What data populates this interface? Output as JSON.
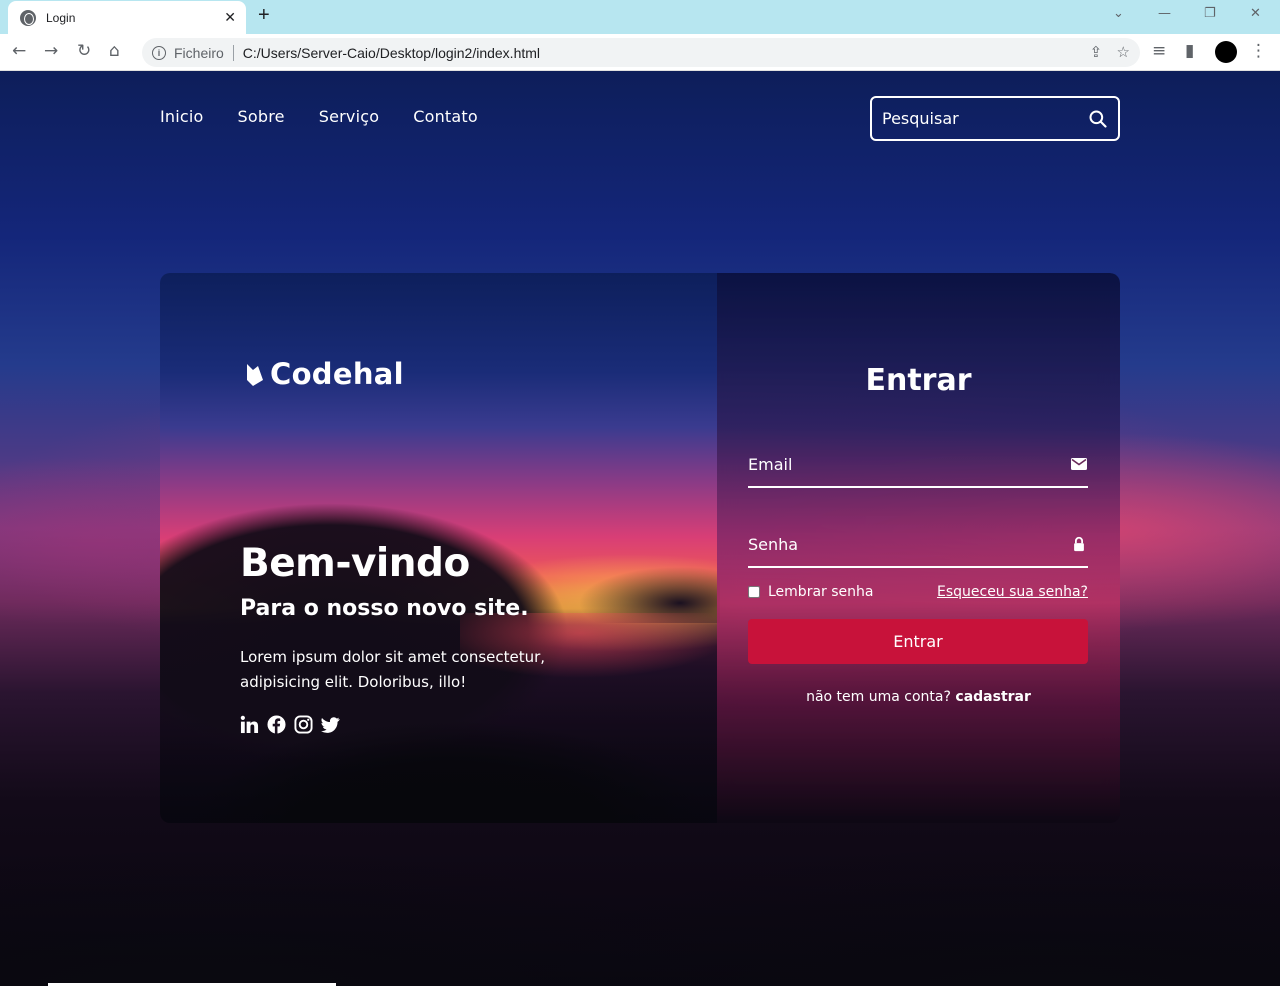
{
  "browser": {
    "tab_title": "Login",
    "tab_close": "✕",
    "new_tab": "+",
    "scheme_label": "Ficheiro",
    "url": "C:/Users/Server-Caio/Desktop/login2/index.html"
  },
  "nav": {
    "items": [
      "Inicio",
      "Sobre",
      "Serviço",
      "Contato"
    ]
  },
  "search": {
    "placeholder": "Pesquisar"
  },
  "card": {
    "logo_text": "Codehal",
    "welcome_title": "Bem-vindo",
    "welcome_subtitle": "Para o nosso novo site.",
    "welcome_description": "Lorem ipsum dolor sit amet consectetur, adipisicing elit. Doloribus, illo!",
    "social_icons": [
      "linkedin-icon",
      "facebook-icon",
      "instagram-icon",
      "twitter-icon"
    ]
  },
  "login": {
    "title": "Entrar",
    "email_placeholder": "Email",
    "password_placeholder": "Senha",
    "remember_label": "Lembrar senha",
    "forgot_label": "Esqueceu sua senha?",
    "submit_label": "Entrar",
    "signup_prompt": "não tem uma conta?",
    "signup_link": "cadastrar"
  },
  "colors": {
    "accent": "#c8123a",
    "tabbar": "#b7e6f0"
  }
}
